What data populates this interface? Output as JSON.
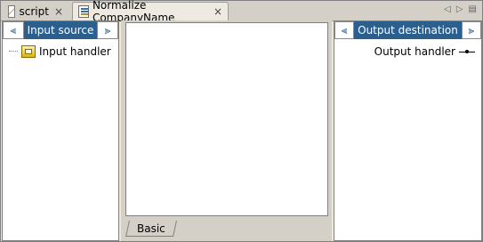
{
  "tabs": [
    {
      "label": "script",
      "icon": "script-icon",
      "active": false
    },
    {
      "label": "Normalize CompanyName",
      "icon": "editor-icon",
      "active": true
    }
  ],
  "tabstrip_controls": {
    "prev": "◁",
    "next": "▷",
    "menu": "▤"
  },
  "left_panel": {
    "title": "Input source",
    "collapse_icon": "⫷",
    "expand_icon": "⫸",
    "tree": [
      {
        "label": "Input handler",
        "icon": "handler-icon"
      }
    ]
  },
  "middle_panel": {
    "tab_label": "Basic"
  },
  "right_panel": {
    "title": "Output destination",
    "collapse_icon": "⫷",
    "expand_icon": "⫸",
    "items": [
      {
        "label": "Output handler",
        "icon": "connector-icon"
      }
    ]
  }
}
